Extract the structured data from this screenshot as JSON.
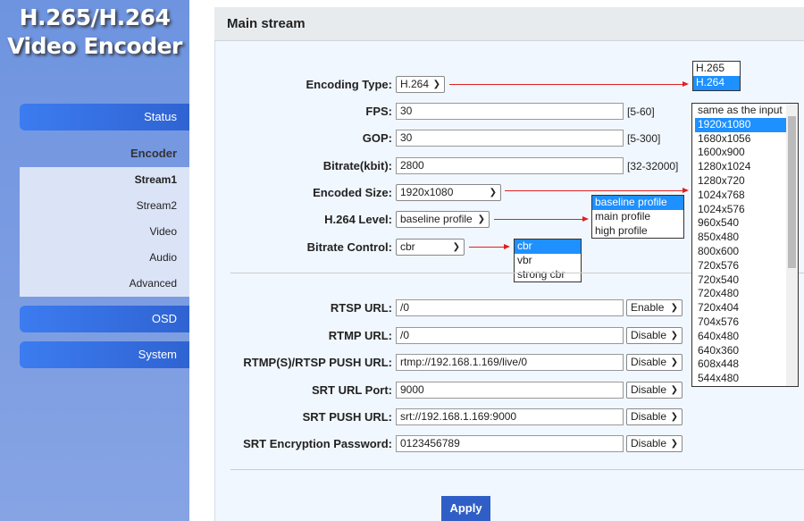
{
  "logo": {
    "line1": "H.265/H.264",
    "line2": "Video Encoder"
  },
  "sidebar": {
    "status": "Status",
    "encoder": "Encoder",
    "sub": [
      "Stream1",
      "Stream2",
      "Video",
      "Audio",
      "Advanced"
    ],
    "osd": "OSD",
    "system": "System",
    "active": "Stream1"
  },
  "header": {
    "title": "Main stream"
  },
  "form": {
    "encoding_type": {
      "label": "Encoding Type:",
      "value": "H.264"
    },
    "fps": {
      "label": "FPS:",
      "value": "30",
      "range": "[5-60]"
    },
    "gop": {
      "label": "GOP:",
      "value": "30",
      "range": "[5-300]"
    },
    "bitrate": {
      "label": "Bitrate(kbit):",
      "value": "2800",
      "range": "[32-32000]"
    },
    "encoded_size": {
      "label": "Encoded Size:",
      "value": "1920x1080"
    },
    "h264_level": {
      "label": "H.264 Level:",
      "value": "baseline profile"
    },
    "bitrate_control": {
      "label": "Bitrate Control:",
      "value": "cbr"
    },
    "rtsp_url": {
      "label": "RTSP URL:",
      "value": "/0",
      "state": "Enable"
    },
    "rtmp_url": {
      "label": "RTMP URL:",
      "value": "/0",
      "state": "Disable"
    },
    "push_url": {
      "label": "RTMP(S)/RTSP PUSH URL:",
      "value": "rtmp://192.168.1.169/live/0",
      "state": "Disable"
    },
    "srt_port": {
      "label": "SRT URL Port:",
      "value": "9000",
      "state": "Disable"
    },
    "srt_push": {
      "label": "SRT PUSH URL:",
      "value": "srt://192.168.1.169:9000",
      "state": "Disable"
    },
    "srt_password": {
      "label": "SRT Encryption Password:",
      "value": "0123456789",
      "state": "Disable"
    }
  },
  "dropdowns": {
    "encoding_options": [
      "H.265",
      "H.264"
    ],
    "size_options": [
      "same as the input",
      "1920x1080",
      "1680x1056",
      "1600x900",
      "1280x1024",
      "1280x720",
      "1024x768",
      "1024x576",
      "960x540",
      "850x480",
      "800x600",
      "720x576",
      "720x540",
      "720x480",
      "720x404",
      "704x576",
      "640x480",
      "640x360",
      "608x448",
      "544x480"
    ],
    "level_options": [
      "baseline profile",
      "main profile",
      "high profile"
    ],
    "control_options": [
      "cbr",
      "vbr",
      "strong cbr"
    ]
  },
  "apply": "Apply",
  "colors": {
    "accent": "#2f5fc6",
    "highlight": "#1e90ff",
    "arrow": "#e02020"
  }
}
